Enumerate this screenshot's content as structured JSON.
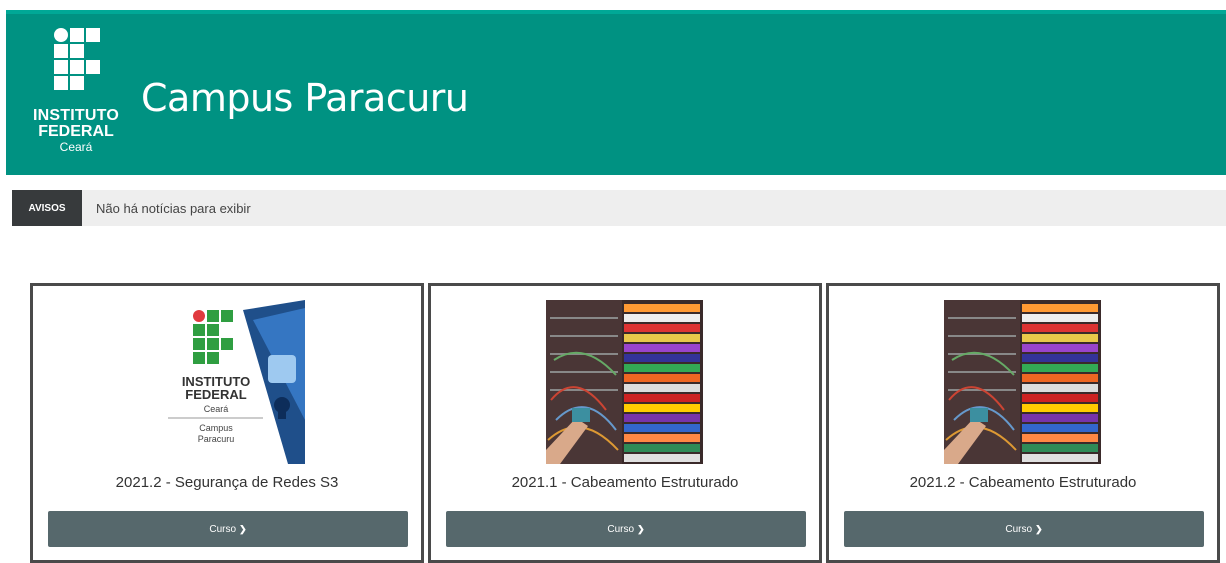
{
  "header": {
    "logo": {
      "line1": "INSTITUTO",
      "line2": "FEDERAL",
      "line3": "Ceará"
    },
    "site_title": "Campus Paracuru"
  },
  "news": {
    "label": "AVISOS",
    "text": "Não há notícias para exibir"
  },
  "courses": [
    {
      "title": "2021.2 - Segurança de Redes S3",
      "button_label": "Curso",
      "image": {
        "kind": "ifce-logo",
        "line1": "INSTITUTO",
        "line2": "FEDERAL",
        "line3": "Ceará",
        "line4": "Campus",
        "line5": "Paracuru"
      }
    },
    {
      "title": "2021.1 - Cabeamento Estruturado",
      "button_label": "Curso",
      "image": {
        "kind": "network-cables"
      }
    },
    {
      "title": "2021.2 - Cabeamento Estruturado",
      "button_label": "Curso",
      "image": {
        "kind": "network-cables"
      }
    }
  ],
  "colors": {
    "header_bg": "#009282",
    "news_label_bg": "#373a3c",
    "button_bg": "#56686c",
    "logo_red": "#e03a3e",
    "logo_green": "#2f9e41"
  }
}
